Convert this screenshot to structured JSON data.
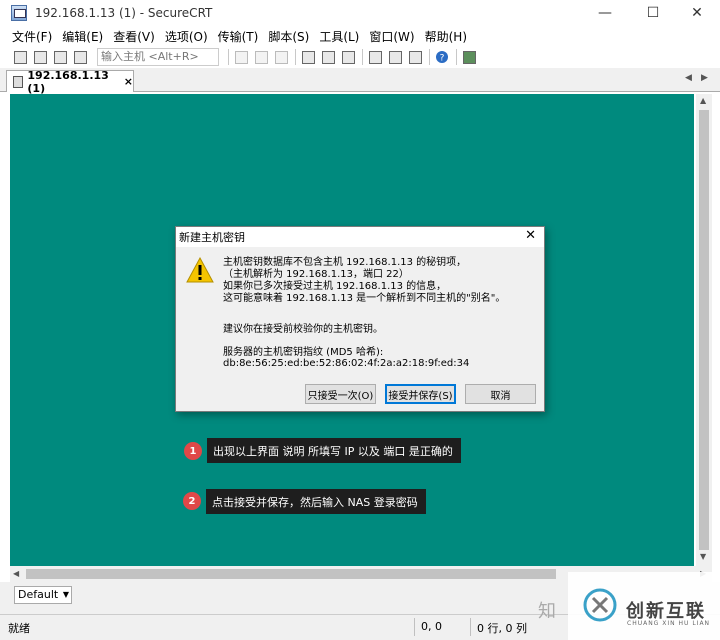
{
  "window": {
    "title": "192.168.1.13 (1) - SecureCRT",
    "minimize_glyph": "—",
    "maximize_glyph": "☐",
    "close_glyph": "✕"
  },
  "menu": {
    "items": [
      "文件(F)",
      "编辑(E)",
      "查看(V)",
      "选项(O)",
      "传输(T)",
      "脚本(S)",
      "工具(L)",
      "窗口(W)",
      "帮助(H)"
    ]
  },
  "toolbar": {
    "connect_placeholder": "输入主机 <Alt+R>"
  },
  "tab": {
    "label": "192.168.1.13 (1)",
    "close_glyph": "×"
  },
  "dialog": {
    "title": "新建主机密钥",
    "close_glyph": "✕",
    "lines": [
      "主机密钥数据库不包含主机 192.168.1.13 的秘钥项，",
      "（主机解析为 192.168.1.13，端口 22）",
      "如果你已多次接受过主机 192.168.1.13 的信息，",
      "这可能意味着 192.168.1.13 是一个解析到不同主机的\"别名\"。"
    ],
    "advice": "建议你在接受前校验你的主机密钥。",
    "fingerprint_label": "服务器的主机密钥指纹 (MD5 哈希):",
    "fingerprint": "db:8e:56:25:ed:be:52:86:02:4f:2a:a2:18:9f:ed:34",
    "buttons": {
      "accept_once": "只接受一次(O)",
      "accept_save": "接受并保存(S)",
      "cancel": "取消"
    }
  },
  "annotations": [
    {
      "number": "1",
      "text": "出现以上界面 说明 所填写 IP 以及 端口 是正确的"
    },
    {
      "number": "2",
      "text": "点击接受并保存，然后输入 NAS 登录密码"
    }
  ],
  "session": {
    "selected": "Default"
  },
  "status": {
    "ready": "就绪",
    "position": "0, 0",
    "rows_cols": "0 行, 0 列"
  },
  "watermark": {
    "zhihu": "知",
    "brand": "创新互联",
    "sub": "CHUANG XIN HU LIAN"
  },
  "colors": {
    "terminal_bg": "#008a7e",
    "annotation_bg": "#1e1e1e",
    "badge_red": "#e04848",
    "focus_blue": "#0078d7"
  }
}
